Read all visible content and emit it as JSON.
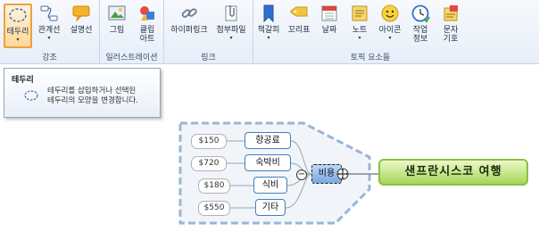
{
  "ribbon": {
    "groups": [
      {
        "label": "강조"
      },
      {
        "label": "일러스트레이션"
      },
      {
        "label": "링크"
      },
      {
        "label": "토픽 요소들"
      }
    ],
    "buttons": {
      "boundary": "테두리",
      "relationship": "관계선",
      "callout": "설명선",
      "picture": "그림",
      "clipart_line1": "클립",
      "clipart_line2": "아트",
      "hyperlink": "하이퍼링크",
      "attachment": "첨부파일",
      "bookmark": "책갈피",
      "tag": "꼬리표",
      "date": "날짜",
      "note": "노트",
      "icon": "아이콘",
      "task_line1": "작업",
      "task_line2": "정보",
      "textmark_line1": "문자",
      "textmark_line2": "기호"
    }
  },
  "tooltip": {
    "title": "테두리",
    "line1": "테두리를 삽입하거나 선택된",
    "line2": "테두리의 모양을 변경합니다."
  },
  "mindmap": {
    "central": "샌프란시스코 여행",
    "topic": "비용",
    "collapse_symbol": "−",
    "items": [
      {
        "label": "항공료",
        "value": "$150"
      },
      {
        "label": "숙박비",
        "value": "$720"
      },
      {
        "label": "식비",
        "value": "$180"
      },
      {
        "label": "기타",
        "value": "$550"
      }
    ]
  },
  "colors": {
    "accent_active": "#f0a03c",
    "boundary_stroke": "#9ab6d4",
    "central_fill": "#a6d559",
    "node_border": "#3f7fc2"
  }
}
